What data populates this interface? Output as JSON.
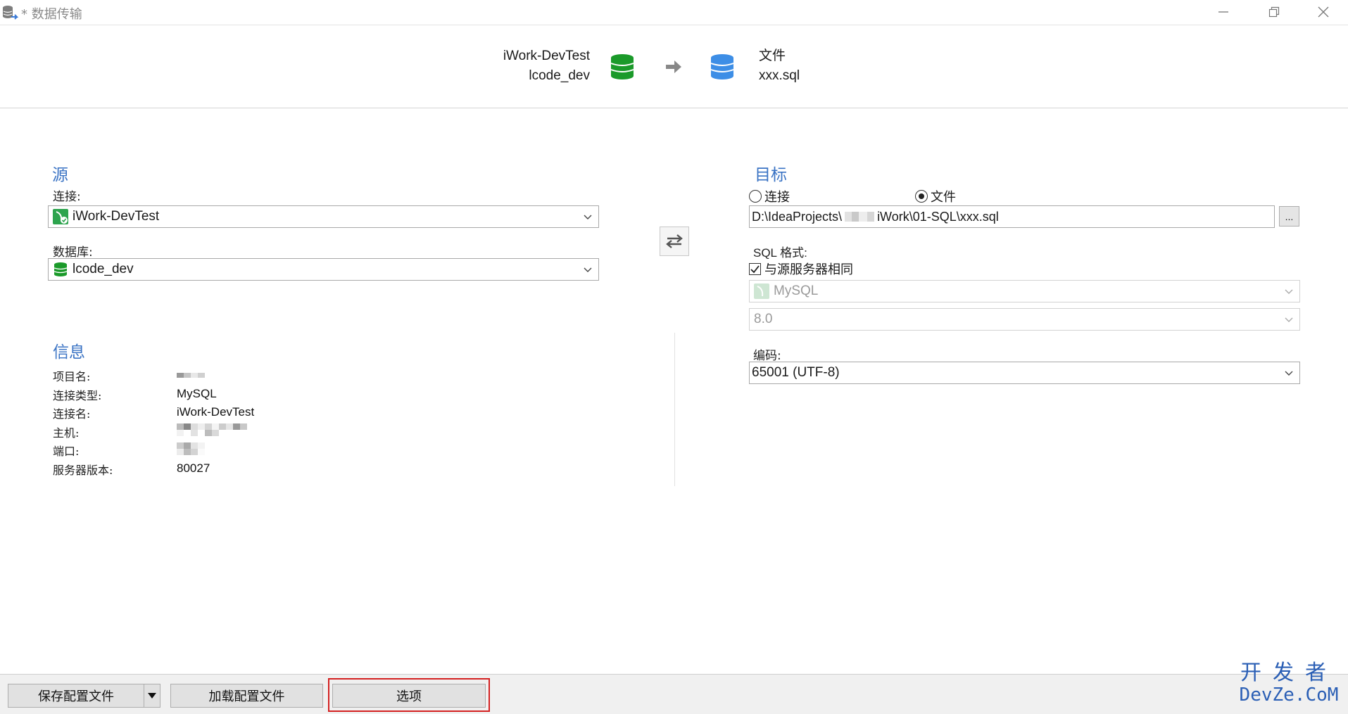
{
  "window": {
    "title": "* 数据传输",
    "accent": "#3a73c4"
  },
  "banner": {
    "source_connection": "iWork-DevTest",
    "source_database": "lcode_dev",
    "target_type": "文件",
    "target_file": "xxx.sql"
  },
  "source": {
    "heading": "源",
    "connection_label": "连接:",
    "connection_value": "iWork-DevTest",
    "database_label": "数据库:",
    "database_value": "lcode_dev"
  },
  "target": {
    "heading": "目标",
    "radio_connection": "连接",
    "radio_file": "文件",
    "selected": "文件",
    "path": "D:\\IdeaProjects\\",
    "path_tail": "iWork\\01-SQL\\xxx.sql",
    "browse_label": "...",
    "sql_format_label": "SQL 格式:",
    "same_as_source_label": "与源服务器相同",
    "same_as_source_checked": true,
    "server_type": "MySQL",
    "server_version": "8.0",
    "encoding_label": "编码:",
    "encoding_value": "65001 (UTF-8)"
  },
  "info": {
    "heading": "信息",
    "rows": [
      {
        "label": "项目名:",
        "value": ""
      },
      {
        "label": "连接类型:",
        "value": "MySQL"
      },
      {
        "label": "连接名:",
        "value": "iWork-DevTest"
      },
      {
        "label": "主机:",
        "value": ""
      },
      {
        "label": "端口:",
        "value": ""
      },
      {
        "label": "服务器版本:",
        "value": "80027"
      }
    ]
  },
  "footer": {
    "save_profile": "保存配置文件",
    "load_profile": "加载配置文件",
    "options": "选项",
    "watermark_line1": "开发者",
    "watermark_line2": "DevZe.CoM"
  },
  "icons": {
    "app": "database-transfer-icon",
    "minimize": "minimize-icon",
    "maximize": "restore-icon",
    "close": "close-icon",
    "swap": "swap-icon",
    "dropdown": "chevron-down-icon"
  }
}
